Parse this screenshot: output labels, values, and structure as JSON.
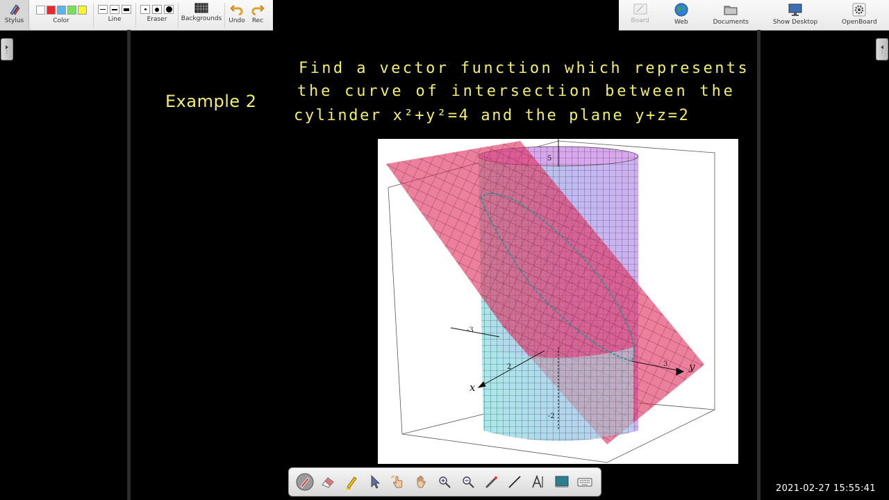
{
  "toolbar_left": {
    "stylus": "Stylus",
    "color": "Color",
    "line": "Line",
    "eraser": "Eraser",
    "backgrounds": "Backgrounds",
    "undo": "Undo",
    "redo": "Rec"
  },
  "colors": [
    "#ffffff",
    "#e8282a",
    "#59b5f2",
    "#78e05a",
    "#f5f52a"
  ],
  "toolbar_right": {
    "board": "Board",
    "web": "Web",
    "documents": "Documents",
    "show_desktop": "Show Desktop",
    "openboard": "OpenBoard"
  },
  "board": {
    "example_label": "Example 2",
    "problem_lines": [
      "Find a vector function which represents",
      "the curve of intersection between the",
      "cylinder x²+y²=4 and the plane y+z=2"
    ]
  },
  "plot": {
    "ticks": {
      "z_top": "5",
      "x_neg": "-3",
      "x_pos": "2",
      "y_pos": "3",
      "z_neg": "-2"
    },
    "axis_x": "x",
    "axis_y": "y"
  },
  "palette_tools": [
    "pen-tool",
    "eraser-tool",
    "highlighter-tool",
    "select-tool",
    "interact-tool",
    "hand-tool",
    "zoom-in-tool",
    "zoom-out-tool",
    "laser-pointer-tool",
    "line-tool",
    "text-tool",
    "capture-tool",
    "keyboard-tool"
  ],
  "timestamp": "2021-02-27 15:55:41"
}
